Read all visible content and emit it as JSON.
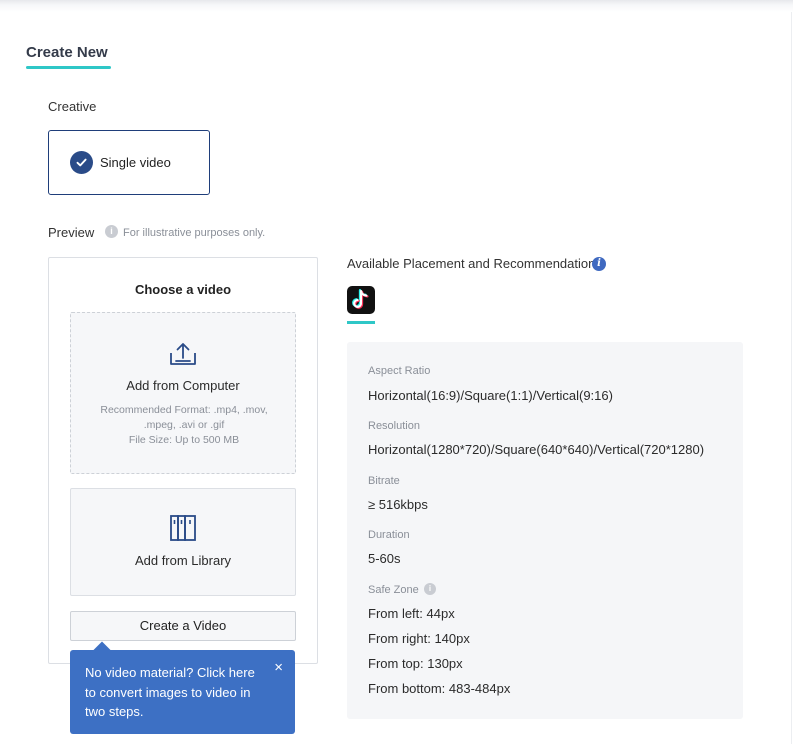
{
  "header": {
    "title": "Create New"
  },
  "creative": {
    "label": "Creative",
    "option_label": "Single video"
  },
  "preview": {
    "label": "Preview",
    "note": "For illustrative purposes only.",
    "choose_title": "Choose a video",
    "computer": {
      "title": "Add from Computer",
      "format_line": "Recommended Format: .mp4, .mov, .mpeg, .avi or .gif",
      "size_line": "File Size: Up to 500 MB"
    },
    "library": {
      "title": "Add from Library"
    },
    "create_button": "Create a Video"
  },
  "tooltip": {
    "text": "No video material? Click here to convert images to video in two steps.",
    "close": "×"
  },
  "placement": {
    "title": "Available Placement and Recommendations",
    "platform_icon": "tiktok-icon",
    "aspect_ratio_label": "Aspect Ratio",
    "aspect_ratio_value": "Horizontal(16:9)/Square(1:1)/Vertical(9:16)",
    "resolution_label": "Resolution",
    "resolution_value": "Horizontal(1280*720)/Square(640*640)/Vertical(720*1280)",
    "bitrate_label": "Bitrate",
    "bitrate_value": "≥ 516kbps",
    "duration_label": "Duration",
    "duration_value": "5-60s",
    "safe_zone_label": "Safe Zone",
    "safe_zone": {
      "left": "From left: 44px",
      "right": "From right: 140px",
      "top": "From top: 130px",
      "bottom": "From bottom: 483-484px"
    }
  },
  "colors": {
    "accent": "#2fc7c7",
    "primary": "#2a4b88",
    "tooltip": "#3d70c4"
  }
}
